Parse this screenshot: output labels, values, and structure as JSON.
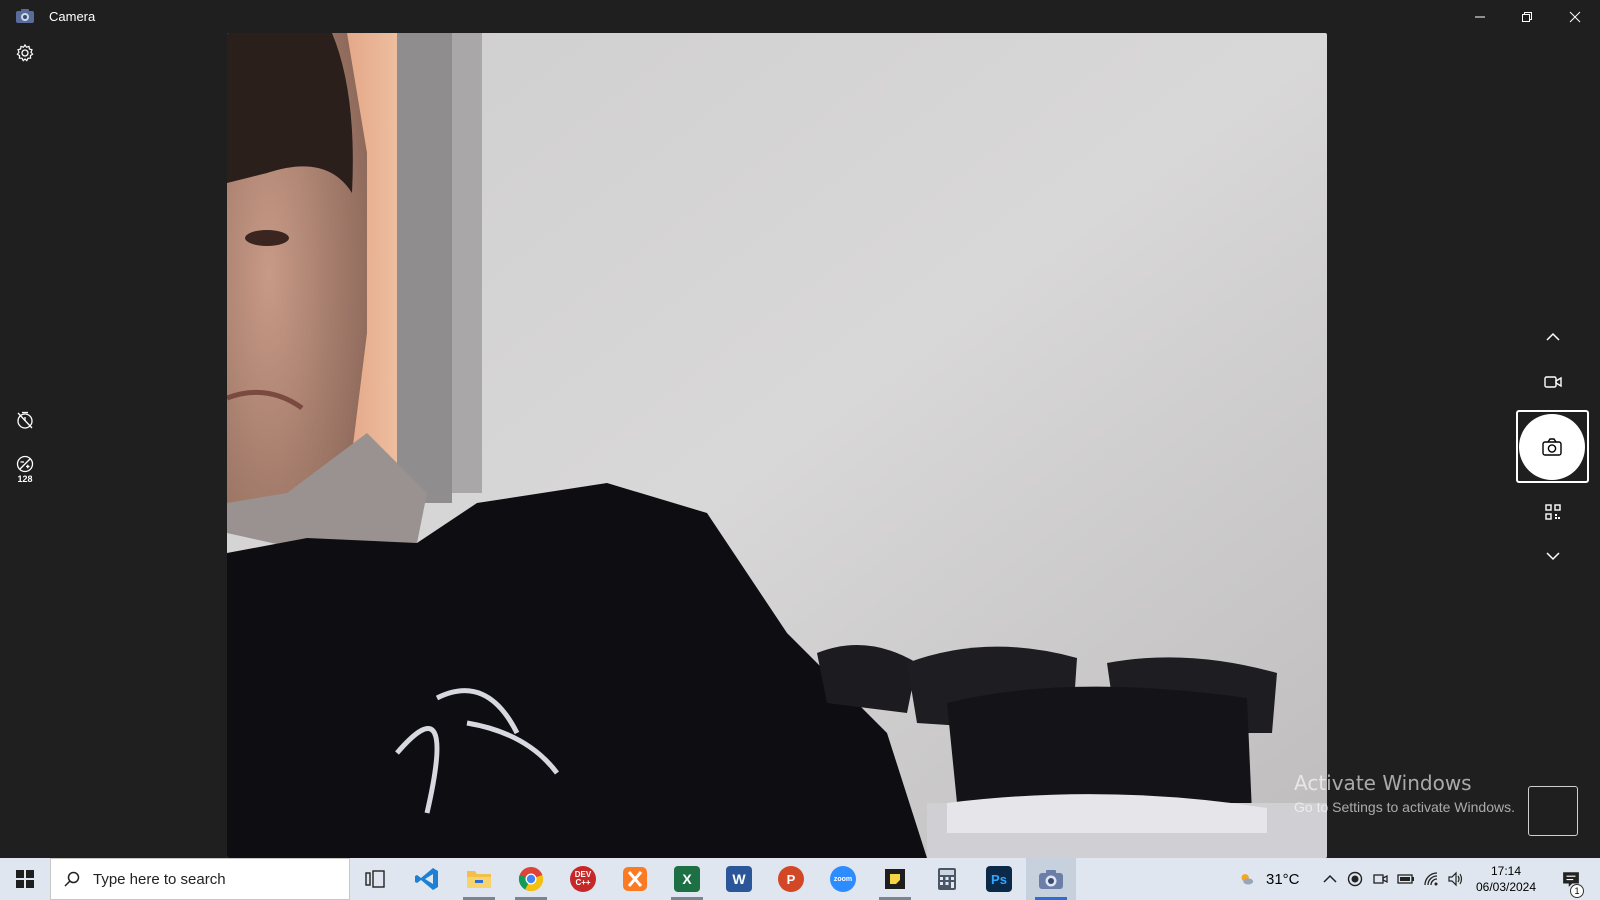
{
  "window": {
    "title": "Camera",
    "icons": [
      "camera-icon",
      "minimize-icon",
      "restore-icon",
      "close-icon"
    ]
  },
  "left_controls": {
    "settings_icon": "gear-icon",
    "timer_icon": "timer-off-icon",
    "brightness_icon": "exposure-icon",
    "brightness_value": "128"
  },
  "right_controls": {
    "icons": [
      "chevron-up-icon",
      "video-icon",
      "camera-icon",
      "qr-code-icon",
      "chevron-down-icon"
    ]
  },
  "watermark": {
    "title": "Activate Windows",
    "subtitle": "Go to Settings to activate Windows."
  },
  "taskbar": {
    "search_placeholder": "Type here to search",
    "apps": [
      {
        "name": "task-view",
        "label": ""
      },
      {
        "name": "vscode",
        "label": ""
      },
      {
        "name": "file-explorer",
        "label": ""
      },
      {
        "name": "chrome",
        "label": ""
      },
      {
        "name": "dev-cpp",
        "label": "DEV C++"
      },
      {
        "name": "xampp",
        "label": ""
      },
      {
        "name": "excel",
        "label": "X"
      },
      {
        "name": "word",
        "label": "W"
      },
      {
        "name": "powerpoint",
        "label": "P"
      },
      {
        "name": "zoom",
        "label": "zoom"
      },
      {
        "name": "sticky-notes",
        "label": ""
      },
      {
        "name": "calculator",
        "label": ""
      },
      {
        "name": "photoshop",
        "label": "Ps"
      },
      {
        "name": "camera",
        "label": ""
      }
    ],
    "weather_temp": "31°C",
    "time": "17:14",
    "date": "06/03/2024",
    "notification_count": "1"
  },
  "colors": {
    "app_bg": "#1f1f1f",
    "taskbar_bg": "#dfe6ef",
    "accent": "#2a6fd6"
  }
}
